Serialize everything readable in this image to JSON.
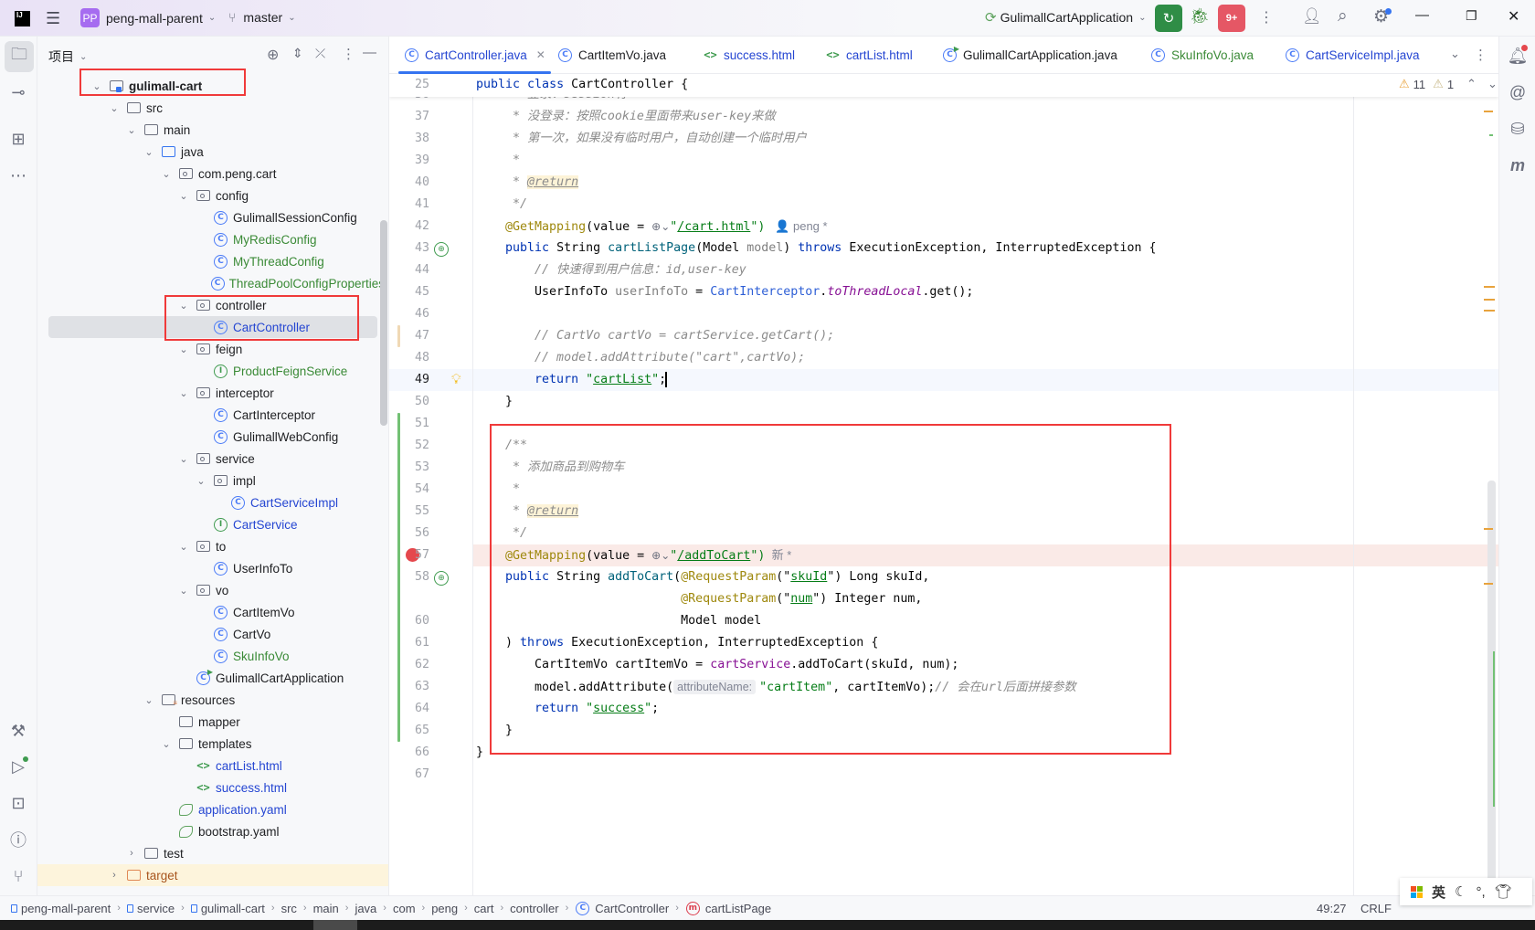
{
  "titlebar": {
    "logo": "IJ",
    "project_badge": "PP",
    "project_name": "peng-mall-parent",
    "branch": "master",
    "run_config": "GulimallCartApplication",
    "stop_badge": "9+"
  },
  "project_panel": {
    "title": "项目",
    "tree": [
      {
        "label": "gulimall-cart",
        "level": 0,
        "kind": "module",
        "chevron": "open",
        "color": "default",
        "bold": true
      },
      {
        "label": "src",
        "level": 1,
        "kind": "folder",
        "chevron": "open",
        "color": "default"
      },
      {
        "label": "main",
        "level": 2,
        "kind": "folder",
        "chevron": "open",
        "color": "default"
      },
      {
        "label": "java",
        "level": 3,
        "kind": "src-folder",
        "chevron": "open",
        "color": "default"
      },
      {
        "label": "com.peng.cart",
        "level": 4,
        "kind": "package",
        "chevron": "open",
        "color": "default"
      },
      {
        "label": "config",
        "level": 5,
        "kind": "package",
        "chevron": "open",
        "color": "default"
      },
      {
        "label": "GulimallSessionConfig",
        "level": 6,
        "kind": "class",
        "color": "default"
      },
      {
        "label": "MyRedisConfig",
        "level": 6,
        "kind": "class",
        "color": "new"
      },
      {
        "label": "MyThreadConfig",
        "level": 6,
        "kind": "class",
        "color": "new"
      },
      {
        "label": "ThreadPoolConfigProperties",
        "level": 6,
        "kind": "class",
        "color": "new"
      },
      {
        "label": "controller",
        "level": 5,
        "kind": "package",
        "chevron": "open",
        "color": "default"
      },
      {
        "label": "CartController",
        "level": 6,
        "kind": "class",
        "color": "modified",
        "selected": true
      },
      {
        "label": "feign",
        "level": 5,
        "kind": "package",
        "chevron": "open",
        "color": "default"
      },
      {
        "label": "ProductFeignService",
        "level": 6,
        "kind": "interface",
        "color": "new"
      },
      {
        "label": "interceptor",
        "level": 5,
        "kind": "package",
        "chevron": "open",
        "color": "default"
      },
      {
        "label": "CartInterceptor",
        "level": 6,
        "kind": "class",
        "color": "default"
      },
      {
        "label": "GulimallWebConfig",
        "level": 6,
        "kind": "class",
        "color": "default"
      },
      {
        "label": "service",
        "level": 5,
        "kind": "package",
        "chevron": "open",
        "color": "default"
      },
      {
        "label": "impl",
        "level": 6,
        "kind": "package",
        "chevron": "open",
        "color": "default"
      },
      {
        "label": "CartServiceImpl",
        "level": 7,
        "kind": "class",
        "color": "modified"
      },
      {
        "label": "CartService",
        "level": 6,
        "kind": "interface",
        "color": "modified"
      },
      {
        "label": "to",
        "level": 5,
        "kind": "package",
        "chevron": "open",
        "color": "default"
      },
      {
        "label": "UserInfoTo",
        "level": 6,
        "kind": "class",
        "color": "default"
      },
      {
        "label": "vo",
        "level": 5,
        "kind": "package",
        "chevron": "open",
        "color": "default"
      },
      {
        "label": "CartItemVo",
        "level": 6,
        "kind": "class",
        "color": "default"
      },
      {
        "label": "CartVo",
        "level": 6,
        "kind": "class",
        "color": "default"
      },
      {
        "label": "SkuInfoVo",
        "level": 6,
        "kind": "class",
        "color": "new"
      },
      {
        "label": "GulimallCartApplication",
        "level": 5,
        "kind": "spring-app",
        "color": "default"
      },
      {
        "label": "resources",
        "level": 3,
        "kind": "resources",
        "chevron": "open",
        "color": "default"
      },
      {
        "label": "mapper",
        "level": 4,
        "kind": "folder",
        "color": "default"
      },
      {
        "label": "templates",
        "level": 4,
        "kind": "folder",
        "chevron": "open",
        "color": "default"
      },
      {
        "label": "cartList.html",
        "level": 5,
        "kind": "html",
        "color": "modified"
      },
      {
        "label": "success.html",
        "level": 5,
        "kind": "html",
        "color": "modified"
      },
      {
        "label": "application.yaml",
        "level": 4,
        "kind": "yaml",
        "color": "modified"
      },
      {
        "label": "bootstrap.yaml",
        "level": 4,
        "kind": "yaml",
        "color": "default"
      },
      {
        "label": "test",
        "level": 2,
        "kind": "folder",
        "chevron": "closed",
        "color": "default"
      },
      {
        "label": "target",
        "level": 1,
        "kind": "target-folder",
        "chevron": "closed",
        "color": "target",
        "highlight": true
      }
    ]
  },
  "tabs": [
    {
      "label": "CartController.java",
      "icon": "class",
      "color": "modified",
      "active": true,
      "closable": true
    },
    {
      "label": "CartItemVo.java",
      "icon": "class",
      "color": "default"
    },
    {
      "label": "success.html",
      "icon": "html",
      "color": "modified"
    },
    {
      "label": "cartList.html",
      "icon": "html",
      "color": "modified"
    },
    {
      "label": "GulimallCartApplication.java",
      "icon": "spring-app",
      "color": "default"
    },
    {
      "label": "SkuInfoVo.java",
      "icon": "class",
      "color": "new"
    },
    {
      "label": "CartServiceImpl.java",
      "icon": "class",
      "color": "modified"
    }
  ],
  "editor": {
    "warnings": "11",
    "weak_warnings": "1",
    "current_line": 49,
    "breakpoint_line": 59,
    "sticky": {
      "n": "25",
      "tokens": [
        {
          "t": "public ",
          "c": "kw"
        },
        {
          "t": "class ",
          "c": "kw"
        },
        {
          "t": "CartController {",
          "c": ""
        }
      ]
    },
    "lines": [
      {
        "n": "36",
        "tokens": [
          {
            "t": "     * 登录：session有",
            "c": "cmt"
          }
        ]
      },
      {
        "n": "37",
        "tokens": [
          {
            "t": "     * 没登录：按照cookie里面带来user-key来做",
            "c": "cmt"
          }
        ]
      },
      {
        "n": "38",
        "tokens": [
          {
            "t": "     * 第一次，如果没有临时用户，自动创建一个临时用户",
            "c": "cmt"
          }
        ]
      },
      {
        "n": "39",
        "tokens": [
          {
            "t": "     *",
            "c": "cmt"
          }
        ]
      },
      {
        "n": "40",
        "tokens": [
          {
            "t": "     * ",
            "c": "cmt"
          },
          {
            "t": "@return",
            "c": "tag"
          }
        ]
      },
      {
        "n": "41",
        "tokens": [
          {
            "t": "     */",
            "c": "cmt"
          }
        ]
      },
      {
        "n": "42",
        "tokens": [
          {
            "t": "    @GetMapping",
            "c": "ann"
          },
          {
            "t": "(value = ",
            "c": ""
          },
          {
            "t": "⊕⌄",
            "c": "globe"
          },
          {
            "t": "\"",
            "c": "str"
          },
          {
            "t": "/cart.html",
            "c": "str u"
          },
          {
            "t": "\")",
            "c": "str"
          },
          {
            "t": "   👤 peng *",
            "c": "hint"
          }
        ]
      },
      {
        "n": "43",
        "icon": "spring-endpoint",
        "tokens": [
          {
            "t": "    public ",
            "c": "kw"
          },
          {
            "t": "String ",
            "c": ""
          },
          {
            "t": "cartListPage",
            "c": "fn"
          },
          {
            "t": "(Model ",
            "c": ""
          },
          {
            "t": "model",
            "c": "unused"
          },
          {
            "t": ") ",
            "c": ""
          },
          {
            "t": "throws ",
            "c": "kw"
          },
          {
            "t": "ExecutionException, InterruptedException {",
            "c": ""
          }
        ]
      },
      {
        "n": "44",
        "tokens": [
          {
            "t": "        // 快速得到用户信息：id,user-key",
            "c": "cmt"
          }
        ]
      },
      {
        "n": "45",
        "tokens": [
          {
            "t": "        UserInfoTo ",
            "c": ""
          },
          {
            "t": "userInfoTo",
            "c": "unused"
          },
          {
            "t": " = ",
            "c": ""
          },
          {
            "t": "CartInterceptor",
            "c": "cls"
          },
          {
            "t": ".",
            "c": ""
          },
          {
            "t": "toThreadLocal",
            "c": "static"
          },
          {
            "t": ".get();",
            "c": ""
          }
        ]
      },
      {
        "n": "46",
        "tokens": []
      },
      {
        "n": "47",
        "tokens": [
          {
            "t": "        // CartVo cartVo = cartService.getCart();",
            "c": "cmt"
          }
        ]
      },
      {
        "n": "48",
        "tokens": [
          {
            "t": "        // model.addAttribute(\"cart\",cartVo);",
            "c": "cmt"
          }
        ]
      },
      {
        "n": "49",
        "icon": "bulb",
        "tokens": [
          {
            "t": "        return ",
            "c": "kw"
          },
          {
            "t": "\"",
            "c": "str"
          },
          {
            "t": "cartList",
            "c": "str u"
          },
          {
            "t": "\"",
            "c": "str"
          },
          {
            "t": ";",
            "c": ""
          }
        ]
      },
      {
        "n": "50",
        "tokens": [
          {
            "t": "    }",
            "c": ""
          }
        ]
      },
      {
        "n": "51",
        "tokens": []
      },
      {
        "n": "52",
        "tokens": [
          {
            "t": "    /**",
            "c": "cmt"
          }
        ]
      },
      {
        "n": "53",
        "tokens": [
          {
            "t": "     * 添加商品到购物车",
            "c": "cmt"
          }
        ]
      },
      {
        "n": "54",
        "tokens": [
          {
            "t": "     *",
            "c": "cmt"
          }
        ]
      },
      {
        "n": "55",
        "tokens": [
          {
            "t": "     * ",
            "c": "cmt"
          },
          {
            "t": "@return",
            "c": "tag"
          }
        ]
      },
      {
        "n": "56",
        "tokens": [
          {
            "t": "     */",
            "c": "cmt"
          }
        ]
      },
      {
        "n": "57",
        "tokens": [
          {
            "t": "    @GetMapping",
            "c": "ann"
          },
          {
            "t": "(value = ",
            "c": ""
          },
          {
            "t": "⊕⌄",
            "c": "globe"
          },
          {
            "t": "\"",
            "c": "str"
          },
          {
            "t": "/addToCart",
            "c": "str u"
          },
          {
            "t": "\")",
            "c": "str"
          },
          {
            "t": "  新 *",
            "c": "hint"
          }
        ]
      },
      {
        "n": "58",
        "icon": "spring-endpoint",
        "tokens": [
          {
            "t": "    public ",
            "c": "kw"
          },
          {
            "t": "String ",
            "c": ""
          },
          {
            "t": "addToCart",
            "c": "fn"
          },
          {
            "t": "(",
            "c": ""
          },
          {
            "t": "@RequestParam",
            "c": "ann"
          },
          {
            "t": "(\"",
            "c": ""
          },
          {
            "t": "skuId",
            "c": "str u"
          },
          {
            "t": "\") Long skuId,",
            "c": ""
          }
        ]
      },
      {
        "n": "59",
        "tokens": [
          {
            "t": "                            ",
            "c": ""
          },
          {
            "t": "@RequestParam",
            "c": "ann"
          },
          {
            "t": "(\"",
            "c": ""
          },
          {
            "t": "num",
            "c": "str u"
          },
          {
            "t": "\") Integer num,",
            "c": ""
          }
        ]
      },
      {
        "n": "60",
        "tokens": [
          {
            "t": "                            Model model",
            "c": ""
          }
        ]
      },
      {
        "n": "61",
        "tokens": [
          {
            "t": "    ) ",
            "c": ""
          },
          {
            "t": "throws ",
            "c": "kw"
          },
          {
            "t": "ExecutionException, InterruptedException {",
            "c": ""
          }
        ]
      },
      {
        "n": "62",
        "tokens": [
          {
            "t": "        CartItemVo cartItemVo = ",
            "c": ""
          },
          {
            "t": "cartService",
            "c": "field"
          },
          {
            "t": ".addToCart(skuId, num);",
            "c": ""
          }
        ]
      },
      {
        "n": "63",
        "tokens": [
          {
            "t": "        model.addAttribute(",
            "c": ""
          },
          {
            "t": "attributeName:",
            "c": "inlay"
          },
          {
            "t": "\"cartItem\"",
            "c": "str"
          },
          {
            "t": ", cartItemVo);",
            "c": ""
          },
          {
            "t": "// 会在url后面拼接参数",
            "c": "cmt"
          }
        ]
      },
      {
        "n": "64",
        "tokens": [
          {
            "t": "        return ",
            "c": "kw"
          },
          {
            "t": "\"",
            "c": "str"
          },
          {
            "t": "success",
            "c": "str u"
          },
          {
            "t": "\"",
            "c": "str"
          },
          {
            "t": ";",
            "c": ""
          }
        ]
      },
      {
        "n": "65",
        "tokens": [
          {
            "t": "    }",
            "c": ""
          }
        ]
      },
      {
        "n": "66",
        "tokens": [
          {
            "t": "}",
            "c": ""
          }
        ]
      },
      {
        "n": "67",
        "tokens": []
      }
    ]
  },
  "statusbar": {
    "breadcrumbs": [
      {
        "label": "peng-mall-parent",
        "icon": "module"
      },
      {
        "label": "service",
        "icon": "module"
      },
      {
        "label": "gulimall-cart",
        "icon": "module"
      },
      {
        "label": "src"
      },
      {
        "label": "main"
      },
      {
        "label": "java"
      },
      {
        "label": "com"
      },
      {
        "label": "peng"
      },
      {
        "label": "cart"
      },
      {
        "label": "controller"
      },
      {
        "label": "CartController",
        "icon": "class"
      },
      {
        "label": "cartListPage",
        "icon": "method"
      }
    ],
    "position": "49:27",
    "line_separator": "CRLF"
  },
  "ime": {
    "language": "英"
  },
  "colors": {
    "accent": "#3574f0",
    "run": "#2f8d46",
    "stop": "#e55765",
    "highlight_box": "#f03a3a",
    "modified": "#2546d2",
    "new": "#3a8a36"
  }
}
